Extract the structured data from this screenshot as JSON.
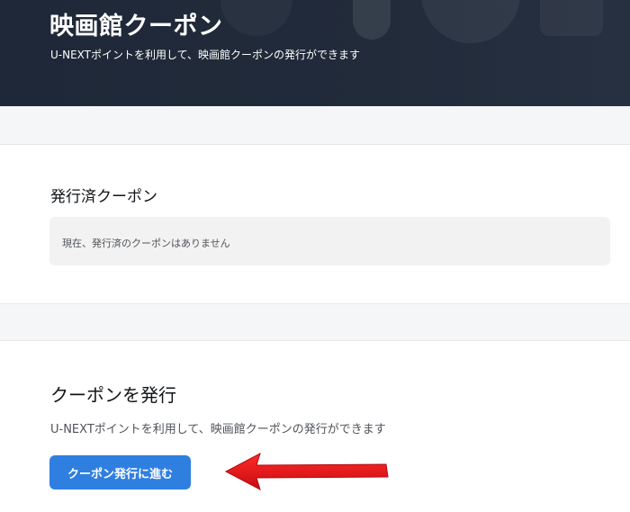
{
  "hero": {
    "title": "映画館クーポン",
    "subtitle": "U-NEXTポイントを利用して、映画館クーポンの発行ができます"
  },
  "issued_section": {
    "title": "発行済クーポン",
    "empty_message": "現在、発行済のクーポンはありません"
  },
  "issue_section": {
    "title": "クーポンを発行",
    "description": "U-NEXTポイントを利用して、映画館クーポンの発行ができます",
    "button_label": "クーポン発行に進む"
  },
  "colors": {
    "hero_bg": "#222b3a",
    "button": "#2f7fe0",
    "arrow": "#e8141a",
    "page_bg": "#f5f6f8"
  },
  "icons": {
    "annotation": "red-arrow-pointing-left"
  }
}
